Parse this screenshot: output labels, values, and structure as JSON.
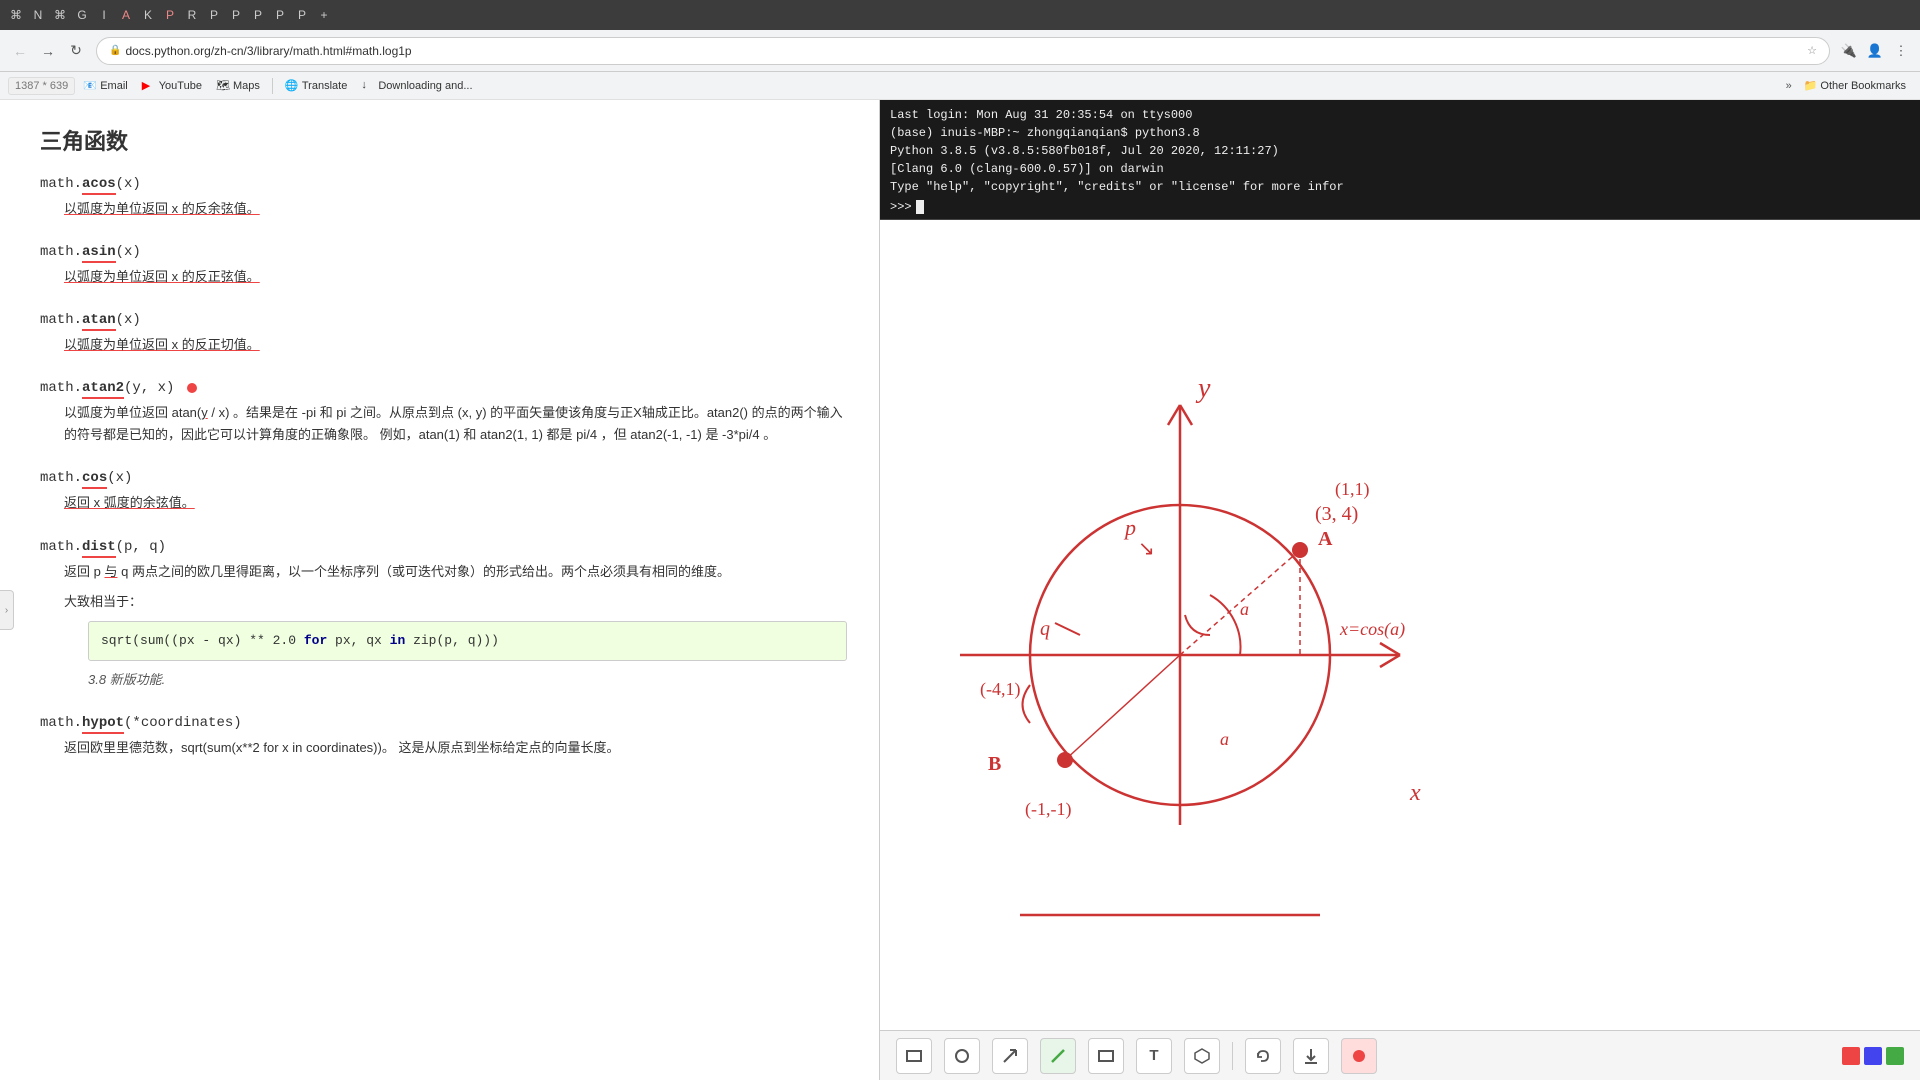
{
  "toolbar": {
    "icons": [
      "⌘",
      "N",
      "⌘",
      "G",
      "⌘",
      "I",
      "A",
      "K",
      "P",
      "R",
      "P",
      "P",
      "P",
      "P",
      "P",
      "P",
      "+"
    ]
  },
  "browser": {
    "address": "docs.python.org/zh-cn/3/library/math.html#math.log1p",
    "dims_badge": "1387 * 639"
  },
  "bookmarks": {
    "items": [
      {
        "icon": "📧",
        "label": "Email"
      },
      {
        "icon": "▶",
        "label": "YouTube",
        "color": "red"
      },
      {
        "icon": "🗺",
        "label": "Maps"
      },
      {
        "icon": "🌐",
        "label": "Translate"
      },
      {
        "icon": "↓",
        "label": "Downloading and..."
      }
    ],
    "other": "Other Bookmarks"
  },
  "docs": {
    "section_title": "三角函数",
    "entries": [
      {
        "sig_module": "math.",
        "sig_func": "acos",
        "sig_args": "(x)",
        "desc": "以弧度为单位返回 x 的反余弦值。"
      },
      {
        "sig_module": "math.",
        "sig_func": "asin",
        "sig_args": "(x)",
        "desc": "以弧度为单位返回 x 的反正弦值。"
      },
      {
        "sig_module": "math.",
        "sig_func": "atan",
        "sig_args": "(x)",
        "desc": "以弧度为单位返回 x 的反正切值。"
      },
      {
        "sig_module": "math.",
        "sig_func": "atan2",
        "sig_args": "(y, x)",
        "desc_main": "以弧度为单位返回 atan(y / x) 。结果是在 -pi 和 pi 之间。从原点到点 (x, y) 的平面矢量使该角度与正X轴成正比。atan2() 的点的两个输入的符号都是已知的，因此它可以计算角度的正确象限。 例如，atan(1) 和 atan2(1, 1) 都是 pi/4 ，但 atan2(-1, -1) 是 -3*pi/4 。"
      },
      {
        "sig_module": "math.",
        "sig_func": "cos",
        "sig_args": "(x)",
        "desc": "返回 x 弧度的余弦值。"
      },
      {
        "sig_module": "math.",
        "sig_func": "dist",
        "sig_args": "(p, q)",
        "desc_main": "返回 p 与 q 两点之间的欧几里得距离，以一个坐标序列（或可迭代对象）的形式给出。两个点必须具有相同的维度。",
        "desc_approx": "大致相当于：",
        "code": "sqrt(sum((px - qx) ** 2.0 for px, qx in zip(p, q)))",
        "version": "3.8 新版功能."
      }
    ],
    "next_entry": {
      "sig_module": "math.",
      "sig_func": "hypot",
      "sig_args": "(*coordinates)",
      "desc": "返回欧里里德范数，sqrt(sum(x**2 for x in coordinates))。 这是从原点到坐标给定点的向量长度。"
    }
  },
  "terminal": {
    "line1": "Last login: Mon Aug 31 20:35:54 on ttys000",
    "line2": "(base) inuis-MBP:~ zhongqianqian$ python3.8",
    "line3": "Python 3.8.5 (v3.8.5:580fb018f, Jul 20 2020, 12:11:27)",
    "line4": "[Clang 6.0 (clang-600.0.57)] on darwin",
    "line5": "Type \"help\", \"copyright\", \"credits\" or \"license\" for more infor",
    "prompt": ">>> "
  },
  "drawing_tools": [
    {
      "name": "rectangle-tool",
      "icon": "□"
    },
    {
      "name": "circle-tool",
      "icon": "○"
    },
    {
      "name": "arrow-tool",
      "icon": "↗"
    },
    {
      "name": "pen-tool",
      "icon": "/"
    },
    {
      "name": "shape-tool",
      "icon": "▭"
    },
    {
      "name": "text-tool",
      "icon": "T"
    },
    {
      "name": "polygon-tool",
      "icon": "⬡"
    },
    {
      "name": "undo-tool",
      "icon": "↺"
    },
    {
      "name": "download-tool",
      "icon": "↓"
    },
    {
      "name": "color-tool",
      "icon": "⬤"
    }
  ]
}
